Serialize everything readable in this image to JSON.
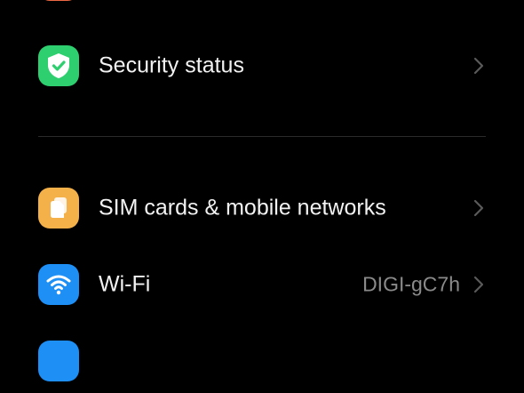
{
  "colors": {
    "background": "#000000",
    "row_text": "#f2f2f2",
    "secondary_text": "#8a8a8a",
    "chevron": "#5a5a5a",
    "divider": "#2b2b2b",
    "top_partial_tile": "#ef6a44",
    "security_tile": "#2ecf6f",
    "sim_tile": "#f4b14a",
    "wifi_tile": "#1e8ff5",
    "bottom_partial_tile": "#1e8ff5"
  },
  "settings": {
    "items": [
      {
        "label": "Security status",
        "icon": "shield-check-icon"
      },
      {
        "label": "SIM cards & mobile networks",
        "icon": "sim-card-icon"
      },
      {
        "label": "Wi-Fi",
        "value": "DIGI-gC7h",
        "icon": "wifi-icon"
      }
    ]
  }
}
